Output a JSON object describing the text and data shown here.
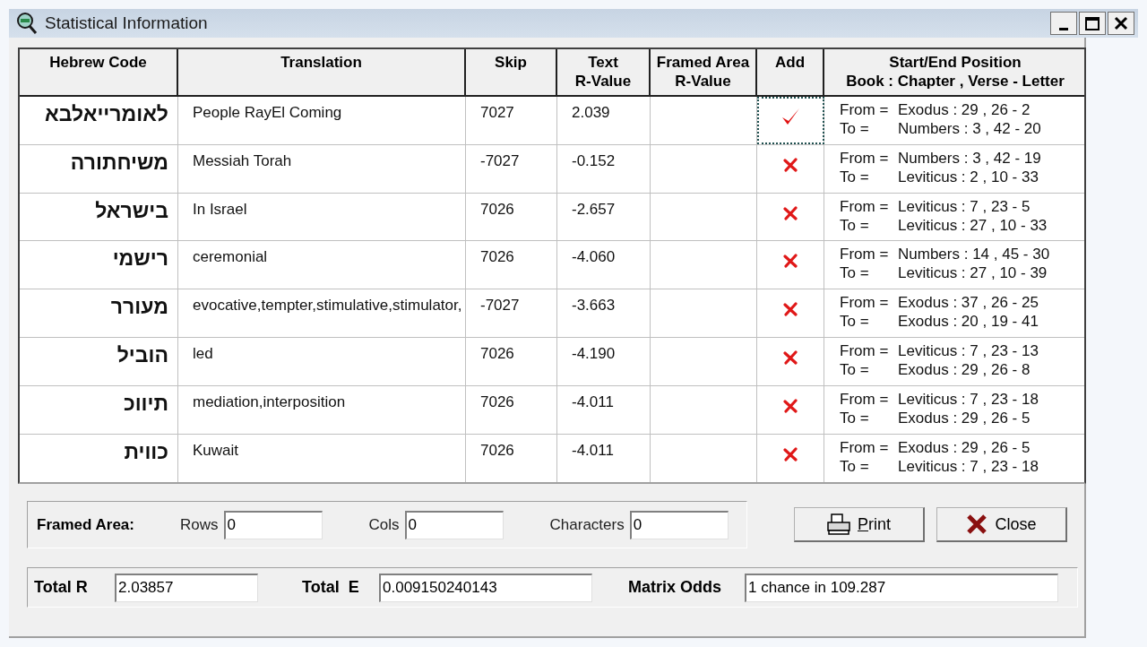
{
  "window": {
    "title": "Statistical Information"
  },
  "table": {
    "columns": [
      "Hebrew Code",
      "Translation",
      "Skip",
      "Text\nR-Value",
      "Framed Area\nR-Value",
      "Add",
      "Start/End Position\nBook : Chapter , Verse - Letter"
    ],
    "rows": [
      {
        "hebrew": "לאומרייאלבא",
        "translation": "People RayEl Coming",
        "skip": "7027",
        "r_value": "2.039",
        "added": true,
        "focused": true,
        "from": {
          "label": "From =",
          "value": "Exodus : 29 , 26 - 2"
        },
        "to": {
          "label": "To =",
          "value": "Numbers : 3 , 42 - 20"
        }
      },
      {
        "hebrew": "משיחתורה",
        "translation": "Messiah Torah",
        "skip": "-7027",
        "r_value": "-0.152",
        "added": false,
        "focused": false,
        "from": {
          "label": "From =",
          "value": "Numbers : 3 , 42 - 19"
        },
        "to": {
          "label": "To =",
          "value": "Leviticus : 2 , 10 - 33"
        }
      },
      {
        "hebrew": "בישראל",
        "translation": "In Israel",
        "skip": "7026",
        "r_value": "-2.657",
        "added": false,
        "focused": false,
        "from": {
          "label": "From =",
          "value": "Leviticus : 7 , 23 - 5"
        },
        "to": {
          "label": "To =",
          "value": "Leviticus : 27 , 10 - 33"
        }
      },
      {
        "hebrew": "רישמי",
        "translation": "ceremonial",
        "skip": "7026",
        "r_value": "-4.060",
        "added": false,
        "focused": false,
        "from": {
          "label": "From =",
          "value": "Numbers : 14 , 45 - 30"
        },
        "to": {
          "label": "To =",
          "value": "Leviticus : 27 , 10 - 39"
        }
      },
      {
        "hebrew": "מעורר",
        "translation": "evocative,tempter,stimulative,stimulator,",
        "skip": "-7027",
        "r_value": "-3.663",
        "added": false,
        "focused": false,
        "from": {
          "label": "From =",
          "value": "Exodus : 37 , 26 - 25"
        },
        "to": {
          "label": "To =",
          "value": "Exodus : 20 , 19 - 41"
        }
      },
      {
        "hebrew": "הוביל",
        "translation": "led",
        "skip": "7026",
        "r_value": "-4.190",
        "added": false,
        "focused": false,
        "from": {
          "label": "From =",
          "value": "Leviticus : 7 , 23 - 13"
        },
        "to": {
          "label": "To =",
          "value": "Exodus : 29 , 26 - 8"
        }
      },
      {
        "hebrew": "תיווכ",
        "translation": "mediation,interposition",
        "skip": "7026",
        "r_value": "-4.011",
        "added": false,
        "focused": false,
        "from": {
          "label": "From =",
          "value": "Leviticus : 7 , 23 - 18"
        },
        "to": {
          "label": "To =",
          "value": "Exodus : 29 , 26 - 5"
        }
      },
      {
        "hebrew": "כווית",
        "translation": "Kuwait",
        "skip": "7026",
        "r_value": "-4.011",
        "added": false,
        "focused": false,
        "from": {
          "label": "From =",
          "value": "Exodus : 29 , 26 - 5"
        },
        "to": {
          "label": "To =",
          "value": "Leviticus : 7 , 23 - 18"
        }
      }
    ]
  },
  "framed_area": {
    "label": "Framed Area:",
    "fields": [
      {
        "label": "Rows",
        "value": "0"
      },
      {
        "label": "Cols",
        "value": "0"
      },
      {
        "label": "Characters",
        "value": "0"
      }
    ]
  },
  "buttons": [
    {
      "kind": "print",
      "label": "Print"
    },
    {
      "kind": "close",
      "label": "Close"
    }
  ],
  "totals": [
    {
      "label": "Total R",
      "value": "2.03857"
    },
    {
      "label": "Total  E",
      "value": "0.009150240143"
    },
    {
      "label": "Matrix Odds",
      "value": "1 chance in 109.287"
    }
  ]
}
